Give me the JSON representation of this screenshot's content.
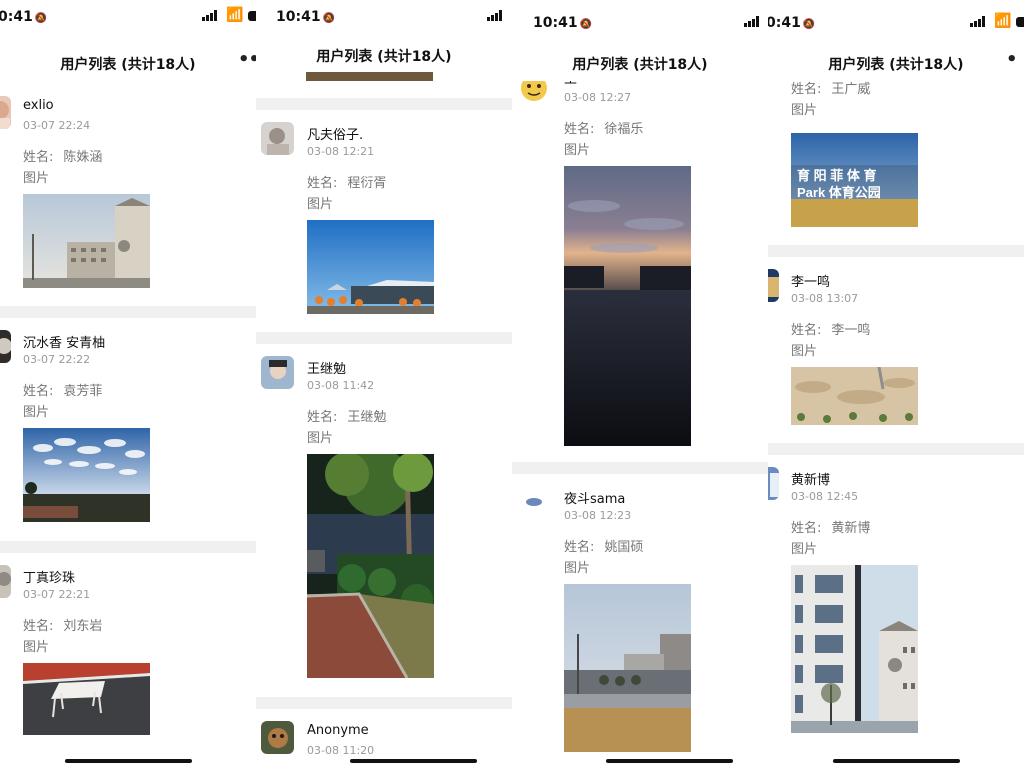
{
  "status_bar": {
    "time_a": "10:41",
    "time_b": "0:41"
  },
  "nav": {
    "title": "用户列表 (共计18人)"
  },
  "labels": {
    "name_prefix": "姓名:",
    "kind": "图片"
  },
  "panels": [
    {
      "cards": [
        {
          "nick": "exlio",
          "date": "03-07 22:24",
          "name": "陈姝涵"
        },
        {
          "nick": "沉水香 安青柚",
          "date": "03-07 22:22",
          "name": "袁芳菲"
        },
        {
          "nick": "丁真珍珠",
          "date": "03-07 22:21",
          "name": "刘东岩"
        }
      ]
    },
    {
      "cards": [
        {
          "nick": "凡夫俗子.",
          "date": "03-08 12:21",
          "name": "程衍胥"
        },
        {
          "nick": "王继勉",
          "date": "03-08 11:42",
          "name": "王继勉"
        },
        {
          "nick": "Anonyme",
          "date": "03-08 11:20"
        }
      ]
    },
    {
      "cards": [
        {
          "nick": "王",
          "date": "03-08 12:27",
          "name": "徐福乐"
        },
        {
          "nick": "夜斗sama",
          "date": "03-08 12:23",
          "name": "姚国硕"
        }
      ]
    },
    {
      "cards": [
        {
          "name": "王广威",
          "sign_top": "育 阳 菲 体 育",
          "sign_bottom": "Park 体育公园"
        },
        {
          "nick": "李一鸣",
          "date": "03-08 13:07",
          "name": "李一鸣"
        },
        {
          "nick": "黄新博",
          "date": "03-08 12:45",
          "name": "黄新博"
        }
      ]
    }
  ],
  "colors": {
    "separator": "#f0f0f0",
    "date_text": "#9a9a9a",
    "label_text": "#777777"
  }
}
